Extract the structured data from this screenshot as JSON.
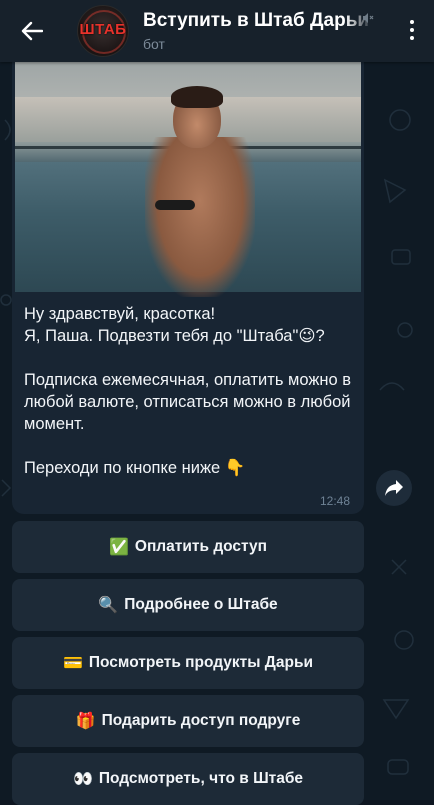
{
  "header": {
    "title": "Вступить в Штаб Дарьи",
    "subtitle": "бот",
    "avatar_text": "ШТАБ"
  },
  "message": {
    "text": "Ну здравствуй, красотка!\nЯ, Паша. Подвезти тебя до \"Штаба\"😉?\n\nПодписка ежемесячная, оплатить можно в любой валюте, отписаться можно в любой момент.\n\nПереходи по кнопке ниже 👇",
    "time": "12:48"
  },
  "buttons": [
    {
      "icon": "✅",
      "label": "Оплатить доступ"
    },
    {
      "icon": "🔍",
      "label": "Подробнее о Штабе"
    },
    {
      "icon": "💳",
      "label": "Посмотреть продукты Дарьи"
    },
    {
      "icon": "🎁",
      "label": "Подарить доступ подруге"
    },
    {
      "icon": "👀",
      "label": "Подсмотреть, что в Штабе"
    }
  ],
  "icons": {
    "back": "back-arrow-icon",
    "mute": "muted-speaker-icon",
    "menu": "more-vertical-icon",
    "share": "share-forward-icon"
  },
  "colors": {
    "header_bg": "#17212b",
    "bubble_bg": "#182533",
    "button_bg": "#1d2a37",
    "chat_bg": "#0f1a24"
  }
}
